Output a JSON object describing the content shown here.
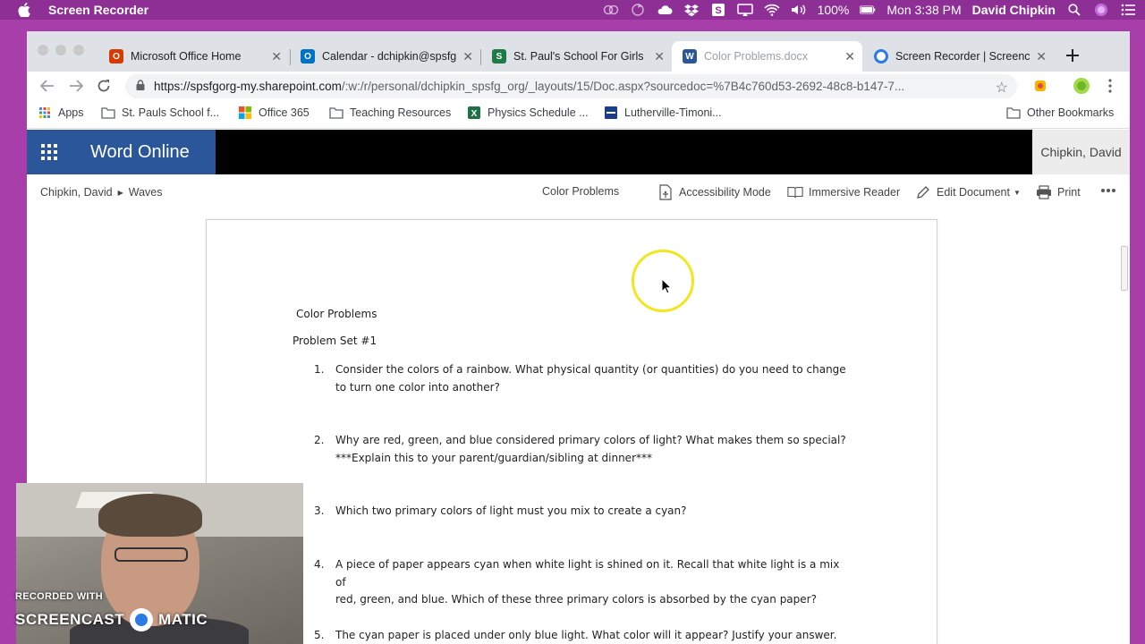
{
  "menubar": {
    "app_name": "Screen Recorder",
    "battery": "100%",
    "clock": "Mon 3:38 PM",
    "user": "David Chipkin"
  },
  "tabs": [
    {
      "label": "Microsoft Office Home",
      "icon": "office-icon",
      "color": "#d83b01"
    },
    {
      "label": "Calendar - dchipkin@spsfg",
      "icon": "outlook-icon",
      "color": "#0072c6"
    },
    {
      "label": "St. Paul's School For Girls",
      "icon": "school-icon",
      "color": "#1e7a46"
    },
    {
      "label": "Color Problems.docx",
      "icon": "word-icon",
      "color": "#2b579a"
    },
    {
      "label": "Screen Recorder | Screenc",
      "icon": "screencast-icon",
      "color": "#2a7be4"
    }
  ],
  "toolbar": {
    "url_host": "https://spsfgorg-my.sharepoint.com",
    "url_path": "/:w:/r/personal/dchipkin_spsfg_org/_layouts/15/Doc.aspx?sourcedoc=%7B4c760d53-2692-48c8-b147-7..."
  },
  "bookmarks": [
    {
      "label": "Apps",
      "icon": "apps-icon"
    },
    {
      "label": "St. Pauls School f...",
      "icon": "folder-icon"
    },
    {
      "label": "Office 365",
      "icon": "office365-icon"
    },
    {
      "label": "Teaching Resources",
      "icon": "folder-icon"
    },
    {
      "label": "Physics Schedule ...",
      "icon": "sheets-icon"
    },
    {
      "label": "Lutherville-Timoni...",
      "icon": "site-icon"
    },
    {
      "label": "Other Bookmarks",
      "icon": "folder-icon"
    }
  ],
  "word": {
    "brand": "Word Online",
    "user": "Chipkin, David",
    "breadcrumb": [
      "Chipkin, David",
      "Waves"
    ],
    "doc_name": "Color Problems",
    "commands": {
      "accessibility": "Accessibility Mode",
      "reader": "Immersive Reader",
      "edit": "Edit Document",
      "print": "Print"
    }
  },
  "document": {
    "title": "Color Problems",
    "set": "Problem Set #1",
    "questions": [
      {
        "num": "1.",
        "line1": "Consider the colors of a rainbow.  What physical quantity (or quantities) do you need to change",
        "line2": "to turn one color into another?"
      },
      {
        "num": "2.",
        "line1": "Why are red, green, and blue considered primary colors of light?  What makes them so special?",
        "line2": "***Explain this to your parent/guardian/sibling at dinner***"
      },
      {
        "num": "3.",
        "line1": "Which two primary colors of light must you mix to create a cyan?",
        "line2": ""
      },
      {
        "num": "4.",
        "line1": "A piece of paper appears cyan when white light is shined on it.  Recall that white light is a mix of",
        "line2": "red, green, and blue.  Which of these three primary colors is absorbed by the cyan paper?"
      },
      {
        "num": "5.",
        "line1": "The cyan paper is placed under only blue light.  What color will it appear?  Justify your answer.",
        "line2": ""
      }
    ]
  },
  "overlay": {
    "recorded_with": "RECORDED WITH",
    "brand_left": "SCREENCAST",
    "brand_right": "MATIC"
  }
}
